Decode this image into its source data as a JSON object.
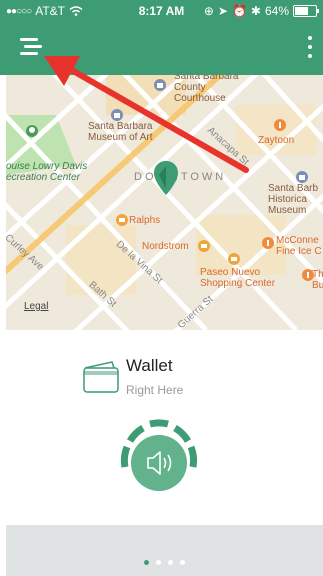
{
  "status_bar": {
    "carrier": "AT&T",
    "time": "8:17 AM",
    "battery": "64%",
    "battery_level": 0.64
  },
  "map": {
    "labels": {
      "courthouse": "Santa Barbara\nCounty\nCourthouse",
      "museum_art": "Santa Barbara\nMuseum of Art",
      "zaytoon": "Zaytoon",
      "lowry": "ouise Lowry Davis\necreation Center",
      "downtown": "DOWNTOWN",
      "historical": "Santa Barb\nHistorica\nMuseum",
      "anacapa": "Anacapa St",
      "ralphs": "Ralphs",
      "nordstrom": "Nordstrom",
      "de_la_vina": "De la Vina St",
      "mcconnell": "McConne\nFine Ice C",
      "curley": "Curley Ave",
      "paseo": "Paseo Nuevo\nShopping Center",
      "the_bu": "Th\nBu",
      "bath": "Bath St",
      "guerra": "Guerra St",
      "legal": "Legal"
    }
  },
  "wallet": {
    "title": "Wallet",
    "subtitle": "Right Here"
  },
  "pagination": {
    "total": 4,
    "active_index": 0
  },
  "colors": {
    "brand_green": "#3d9c73",
    "annotation_arrow": "#e8322c"
  },
  "icons": {
    "menu": "hamburger-menu-icon",
    "more": "vertical-ellipsis-icon",
    "wallet": "wallet-icon",
    "sound": "speaker-icon"
  }
}
